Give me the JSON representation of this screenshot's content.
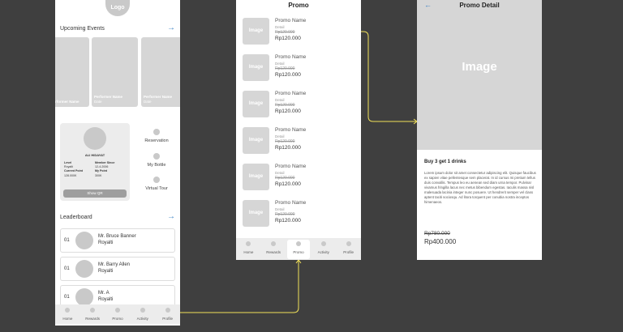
{
  "home": {
    "logo": "Logo",
    "upcoming_title": "Upcoming Events",
    "events": [
      {
        "name": "rformer Name",
        "date": ""
      },
      {
        "name": "Performer Name",
        "date": "Date"
      },
      {
        "name": "Performer Name",
        "date": "Date"
      }
    ],
    "profile": {
      "name": "ALI HIDAYAT",
      "level_label": "Level",
      "level": "Royalti",
      "since_label": "Member Since",
      "since": "12-4-2006",
      "point_label": "Current Point",
      "point": "128.000K",
      "mypoint_label": "My Point",
      "mypoint": "300K",
      "qr_button": "Show QR"
    },
    "side_menu": [
      "Reservation",
      "My Bottle",
      "Virtual Tour"
    ],
    "leaderboard_title": "Leaderboard",
    "leaderboard": [
      {
        "rank": "01",
        "name": "Mr. Bruce Banner",
        "level": "Royalti"
      },
      {
        "rank": "01",
        "name": "Mr. Barry Allen",
        "level": "Royalti"
      },
      {
        "rank": "01",
        "name": "Mr. A",
        "level": "Royalti"
      }
    ]
  },
  "nav": [
    "Home",
    "Rewards",
    "Promo",
    "Activity",
    "Profile"
  ],
  "promo": {
    "title": "Promo",
    "image_label": "Image",
    "items": [
      {
        "name": "Promo Name",
        "detail": "Detail",
        "old_price": "Rp120.000",
        "price": "Rp120.000"
      },
      {
        "name": "Promo Name",
        "detail": "Detail",
        "old_price": "Rp120.000",
        "price": "Rp120.000"
      },
      {
        "name": "Promo Name",
        "detail": "Detail",
        "old_price": "Rp120.000",
        "price": "Rp120.000"
      },
      {
        "name": "Promo Name",
        "detail": "Detail",
        "old_price": "Rp120.000",
        "price": "Rp120.000"
      },
      {
        "name": "Promo Name",
        "detail": "Detail",
        "old_price": "Rp120.000",
        "price": "Rp120.000"
      },
      {
        "name": "Promo Name",
        "detail": "Detail",
        "old_price": "Rp120.000",
        "price": "Rp120.000"
      }
    ]
  },
  "detail": {
    "title": "Promo Detail",
    "image_label": "Image",
    "heading": "Buy 3 get 1 drinks",
    "description": "Lorem ipsum dolor sit amet consectetur adipiscing elit. Quisque faucibus ex sapien vitae pellentesque sem placerat. In id cursus mi pretium tellus duis convallis. Tempus leo eu aenean sed diam urna tempor. Pulvinar vivamus fringilla lacus nec metus bibendum egestas. Iaculis massa nisl malesuada lacinia integer nunc posuere. Ut hendrerit semper vel class aptent taciti sociosqu. Ad litora torquent per conubia nostra inceptos himenaeos.",
    "old_price": "Rp780.000",
    "price": "Rp400.000"
  },
  "colors": {
    "accent": "#3b82c4",
    "connector": "#f2e15a",
    "background": "#3f3f3f"
  }
}
